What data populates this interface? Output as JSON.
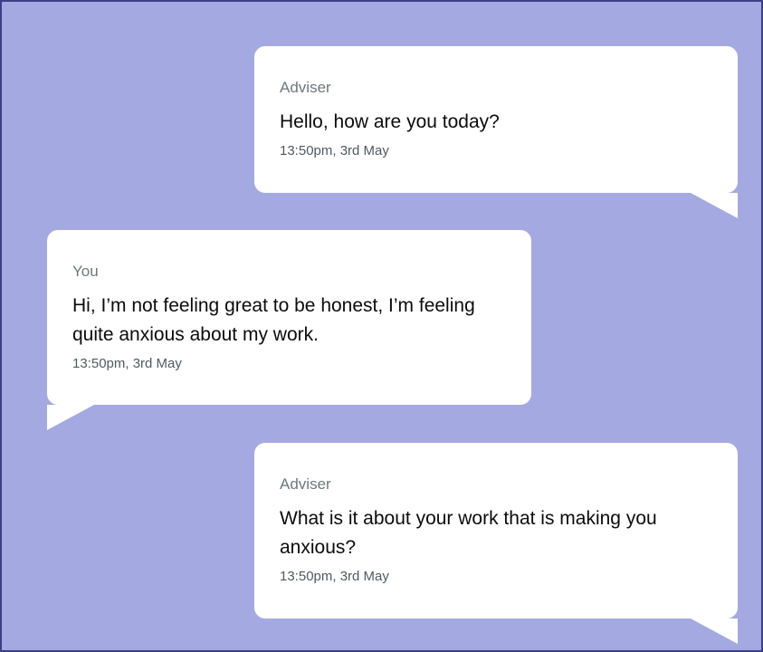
{
  "conversation": {
    "messages": [
      {
        "sender": "Adviser",
        "text": "Hello, how are you today?",
        "timestamp": "13:50pm, 3rd May",
        "side": "right"
      },
      {
        "sender": "You",
        "text": "Hi, I’m not feeling great to be honest, I’m feeling quite anxious about my work.",
        "timestamp": "13:50pm, 3rd May",
        "side": "left"
      },
      {
        "sender": "Adviser",
        "text": "What is it about your work that is making you anxious?",
        "timestamp": "13:50pm, 3rd May",
        "side": "right"
      }
    ]
  },
  "colors": {
    "background": "#a5a9e1",
    "border": "#3d3f86",
    "bubble": "#ffffff",
    "sender_text": "#6f777b",
    "message_text": "#0b0c0c",
    "timestamp_text": "#505a5f"
  }
}
